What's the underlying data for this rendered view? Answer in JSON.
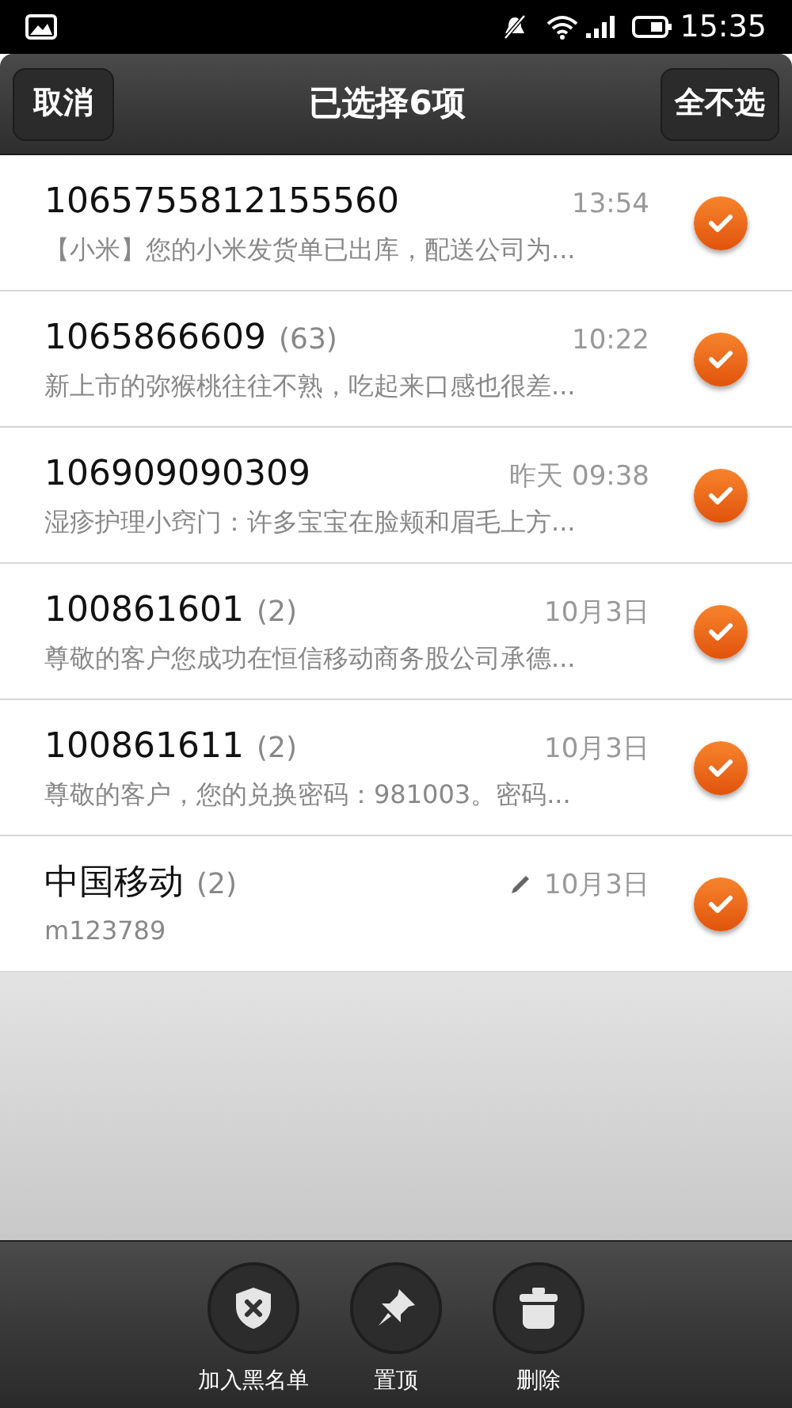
{
  "status_bar": {
    "time": "15:35"
  },
  "header": {
    "cancel": "取消",
    "title": "已选择6项",
    "deselect_all": "全不选"
  },
  "messages": [
    {
      "sender": "1065755812155560",
      "time": "13:54",
      "preview": "【小米】您的小米发货单已出库，配送公司为...",
      "selected": true,
      "draft": false
    },
    {
      "sender": "1065866609",
      "count": "(63)",
      "time": "10:22",
      "preview": "新上市的弥猴桃往往不熟，吃起来口感也很差...",
      "selected": true,
      "draft": false
    },
    {
      "sender": "106909090309",
      "time": "昨天 09:38",
      "preview": "湿疹护理小窍门：许多宝宝在脸颊和眉毛上方...",
      "selected": true,
      "draft": false
    },
    {
      "sender": "100861601",
      "count": "(2)",
      "time": "10月3日",
      "preview": "尊敬的客户您成功在恒信移动商务股公司承德...",
      "selected": true,
      "draft": false
    },
    {
      "sender": "100861611",
      "count": "(2)",
      "time": "10月3日",
      "preview": "尊敬的客户，您的兑换密码：981003。密码...",
      "selected": true,
      "draft": false
    },
    {
      "sender": "中国移动",
      "count": "(2)",
      "time": "10月3日",
      "preview": "m123789",
      "selected": true,
      "draft": true
    }
  ],
  "actions": [
    {
      "kind": "blacklist",
      "label": "加入黑名单"
    },
    {
      "kind": "pin",
      "label": "置顶"
    },
    {
      "kind": "delete",
      "label": "删除"
    }
  ]
}
